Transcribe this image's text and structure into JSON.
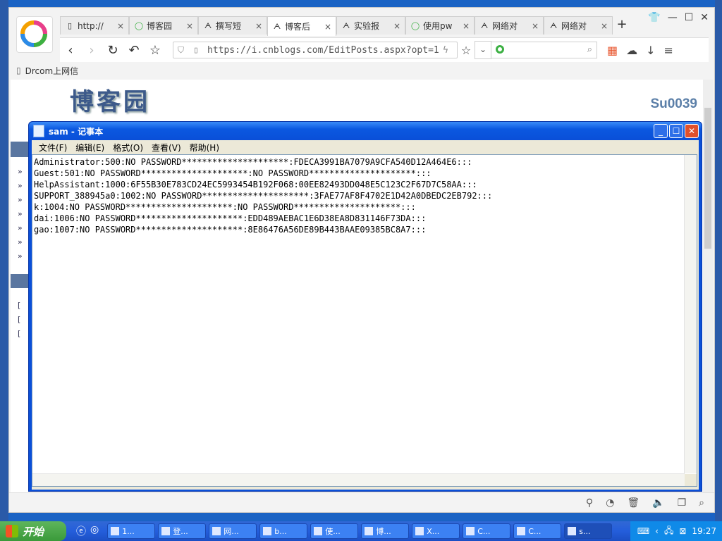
{
  "browser": {
    "tabs": [
      {
        "label": "http://",
        "icon": "page-icon",
        "active": false
      },
      {
        "label": "博客园",
        "icon": "green-circle-icon",
        "active": false
      },
      {
        "label": "撰写短",
        "icon": "cnblogs-icon",
        "active": false
      },
      {
        "label": "博客后",
        "icon": "cnblogs-icon",
        "active": true
      },
      {
        "label": "实验报",
        "icon": "cnblogs-icon",
        "active": false
      },
      {
        "label": "使用pw",
        "icon": "green-circle-icon",
        "active": false
      },
      {
        "label": "网络对",
        "icon": "cnblogs-icon",
        "active": false
      },
      {
        "label": "网络对",
        "icon": "cnblogs-icon",
        "active": false
      }
    ],
    "url": "https://i.cnblogs.com/EditPosts.aspx?opt=1",
    "bookmark": "Drcom上网信"
  },
  "page": {
    "logo": "博客园",
    "user": "Su0039"
  },
  "notepad": {
    "title": "sam - 记事本",
    "menu": [
      "文件(F)",
      "编辑(E)",
      "格式(O)",
      "查看(V)",
      "帮助(H)"
    ],
    "lines": [
      "Administrator:500:NO PASSWORD*********************:FDECA3991BA7079A9CFA540D12A464E6:::",
      "Guest:501:NO PASSWORD*********************:NO PASSWORD*********************:::",
      "HelpAssistant:1000:6F55B30E783CD24EC5993454B192F068:00EE82493DD048E5C123C2F67D7C58AA:::",
      "SUPPORT_388945a0:1002:NO PASSWORD*********************:3FAE77AF8F4702E1D42A0DBEDC2EB792:::",
      "k:1004:NO PASSWORD*********************:NO PASSWORD*********************:::",
      "dai:1006:NO PASSWORD*********************:EDD489AEBAC1E6D38EA8D831146F73DA:::",
      "gao:1007:NO PASSWORD*********************:8E86476A56DE89B443BAAE09385BC8A7:::"
    ]
  },
  "taskbar": {
    "start": "开始",
    "tasks": [
      "1...",
      "登...",
      "网...",
      "b...",
      "使...",
      "博...",
      "X...",
      "C...",
      "C...",
      "s..."
    ],
    "clock": "19:27"
  }
}
